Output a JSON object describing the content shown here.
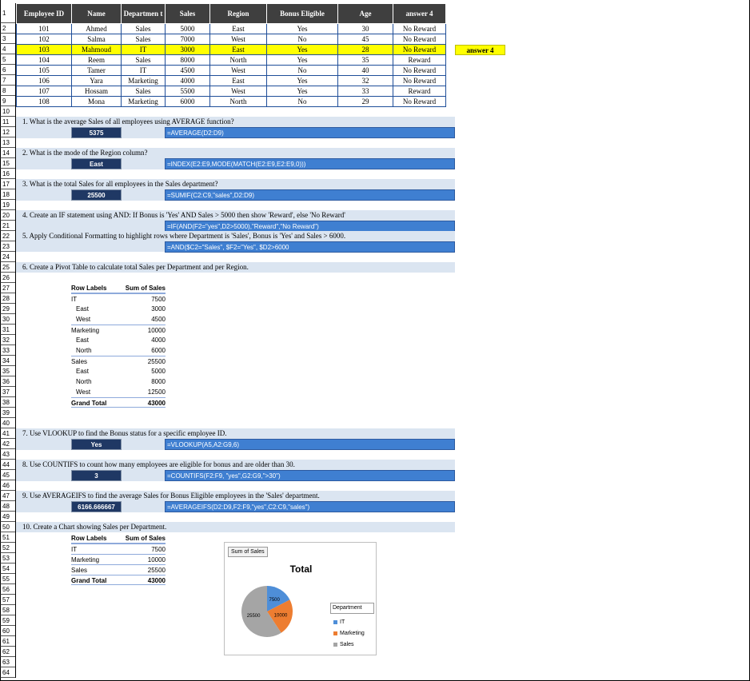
{
  "table": {
    "headers": [
      "Employee ID",
      "Name",
      "Departmen t",
      "Sales",
      "Region",
      "Bonus Eligible",
      "Age",
      "answer 4"
    ],
    "rows": [
      [
        "101",
        "Ahmed",
        "Sales",
        "5000",
        "East",
        "Yes",
        "30",
        "No Reward"
      ],
      [
        "102",
        "Salma",
        "Sales",
        "7000",
        "West",
        "No",
        "45",
        "No Reward"
      ],
      [
        "103",
        "Mahmoud",
        "IT",
        "3000",
        "East",
        "Yes",
        "28",
        "No Reward"
      ],
      [
        "104",
        "Reem",
        "Sales",
        "8000",
        "North",
        "Yes",
        "35",
        "Reward"
      ],
      [
        "105",
        "Tamer",
        "IT",
        "4500",
        "West",
        "No",
        "40",
        "No Reward"
      ],
      [
        "106",
        "Yara",
        "Marketing",
        "4000",
        "East",
        "Yes",
        "32",
        "No Reward"
      ],
      [
        "107",
        "Hossam",
        "Sales",
        "5500",
        "West",
        "Yes",
        "33",
        "Reward"
      ],
      [
        "108",
        "Mona",
        "Marketing",
        "6000",
        "North",
        "No",
        "29",
        "No Reward"
      ]
    ],
    "highlight_row": 2,
    "side_label": "answer 4"
  },
  "questions": [
    {
      "text": "1.    What is the average Sales of all employees using AVERAGE function?",
      "answer": "5375",
      "formula": "=AVERAGE(D2:D9)"
    },
    {
      "text": "2.    What is the mode of the Region column?",
      "answer": "East",
      "formula": "=INDEX(E2:E9,MODE(MATCH(E2:E9,E2:E9,0)))"
    },
    {
      "text": "3.    What is the total Sales for all employees in the Sales department?",
      "answer": "25500",
      "formula": "=SUMIF(C2:C9,\"sales\",D2:D9)"
    },
    {
      "text": "4.  Create an IF statement using AND: If Bonus is 'Yes' AND Sales > 5000 then show 'Reward', else 'No Reward'",
      "answer": "",
      "formula": "=IF(AND(F2=\"yes\",D2>5000),\"Reward\",\"No Reward\")"
    },
    {
      "text": "5.    Apply Conditional Formatting to highlight rows where Department is 'Sales', Bonus is 'Yes' and Sales > 6000.",
      "answer": "",
      "formula": "=AND($C2=\"Sales\", $F2=\"Yes\", $D2>6000"
    },
    {
      "text": "6.    Create a Pivot Table to calculate total Sales per Department and per Region.",
      "answer": "",
      "formula": ""
    },
    {
      "text": "7.  Use VLOOKUP to find the Bonus status for a specific employee ID.",
      "answer": "Yes",
      "formula": "=VLOOKUP(A5,A2:G9,6)"
    },
    {
      "text": "8. Use COUNTIFS to count how many employees are eligible for bonus and are older than 30.",
      "answer": "3",
      "formula": "=COUNTIFS(F2:F9, \"yes\",G2:G9,\">30\")"
    },
    {
      "text": "9.    Use AVERAGEIFS to find the average Sales for Bonus Eligible employees in the 'Sales' department.",
      "answer": "6166.666667",
      "formula": "=AVERAGEIFS(D2:D9,F2:F9,\"yes\",C2:C9,\"sales\")"
    },
    {
      "text": "10.    Create a Chart showing Sales per Department.",
      "answer": "",
      "formula": ""
    }
  ],
  "pivot1": {
    "header": [
      "Row Labels",
      "Sum of Sales"
    ],
    "rows": [
      {
        "label": "IT",
        "value": "7500",
        "kind": "group"
      },
      {
        "label": "East",
        "value": "3000",
        "kind": "sub"
      },
      {
        "label": "West",
        "value": "4500",
        "kind": "sub"
      },
      {
        "label": "Marketing",
        "value": "10000",
        "kind": "group"
      },
      {
        "label": "East",
        "value": "4000",
        "kind": "sub"
      },
      {
        "label": "North",
        "value": "6000",
        "kind": "sub"
      },
      {
        "label": "Sales",
        "value": "25500",
        "kind": "group"
      },
      {
        "label": "East",
        "value": "5000",
        "kind": "sub"
      },
      {
        "label": "North",
        "value": "8000",
        "kind": "sub"
      },
      {
        "label": "West",
        "value": "12500",
        "kind": "sub"
      }
    ],
    "total": [
      "Grand Total",
      "43000"
    ]
  },
  "pivot2": {
    "header": [
      "Row Labels",
      "Sum of Sales"
    ],
    "rows": [
      {
        "label": "IT",
        "value": "7500",
        "kind": "group"
      },
      {
        "label": "Marketing",
        "value": "10000",
        "kind": "group"
      },
      {
        "label": "Sales",
        "value": "25500",
        "kind": "group"
      }
    ],
    "total": [
      "Grand Total",
      "43000"
    ]
  },
  "chart": {
    "field_button": "Sum of Sales",
    "title": "Total",
    "legend_title": "Department",
    "slices": [
      {
        "name": "IT",
        "value": 7500,
        "label": "7500",
        "color": "#4e8ed8"
      },
      {
        "name": "Marketing",
        "value": 10000,
        "label": "10000",
        "color": "#ed7d31"
      },
      {
        "name": "Sales",
        "value": 25500,
        "label": "25500",
        "color": "#a5a5a5"
      }
    ]
  },
  "chart_data": {
    "type": "pie",
    "title": "Total",
    "categories": [
      "IT",
      "Marketing",
      "Sales"
    ],
    "values": [
      7500,
      10000,
      25500
    ],
    "legend": "right"
  },
  "row_count": 64
}
